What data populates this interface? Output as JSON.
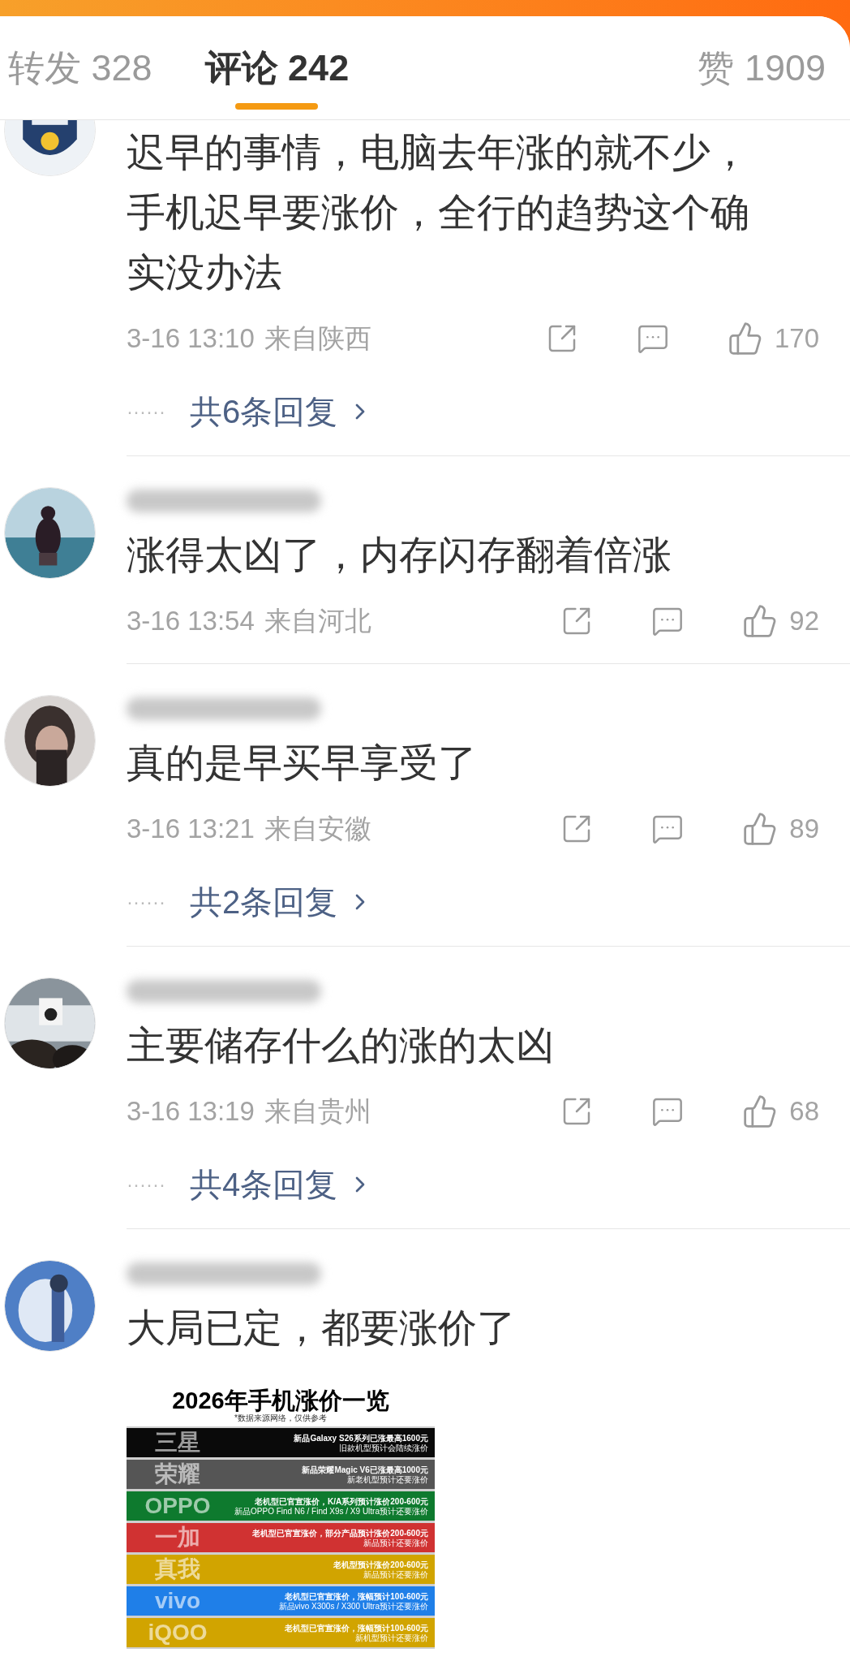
{
  "tabs": [
    {
      "label": "转发 328",
      "selected": false
    },
    {
      "label": "评论 242",
      "selected": true
    },
    {
      "label": "赞 1909",
      "selected": false
    }
  ],
  "comments": [
    {
      "text": "迟早的事情，电脑去年涨的就不少，手机迟早要涨价，全行的趋势这个确实没办法",
      "time": "3-16 13:10",
      "location": "来自陕西",
      "likes": "170",
      "replies": {
        "dots": "······",
        "label": "共6条回复"
      }
    },
    {
      "name_blurred": true,
      "text": "涨得太凶了，内存闪存翻着倍涨",
      "time": "3-16 13:54",
      "location": "来自河北",
      "likes": "92"
    },
    {
      "name_blurred": true,
      "text": "真的是早买早享受了",
      "time": "3-16 13:21",
      "location": "来自安徽",
      "likes": "89",
      "replies": {
        "dots": "······",
        "label": "共2条回复"
      }
    },
    {
      "name_blurred": true,
      "text": "主要储存什么的涨的太凶",
      "time": "3-16 13:19",
      "location": "来自贵州",
      "likes": "68",
      "replies": {
        "dots": "······",
        "label": "共4条回复"
      }
    },
    {
      "name_blurred": true,
      "text": "大局已定，都要涨价了",
      "attachment": {
        "title": "2026年手机涨价一览",
        "note": "*数据来源网络，仅供参考",
        "rows": [
          {
            "brand": "三星",
            "color": "#0a0a0a",
            "lines": [
              "新品Galaxy S26系列已涨最高1600元",
              "旧款机型预计会陆续涨价"
            ]
          },
          {
            "brand": "荣耀",
            "color": "#555555",
            "lines": [
              "新品荣耀Magic V6已涨最高1000元",
              "新老机型预计还要涨价"
            ]
          },
          {
            "brand": "OPPO",
            "color": "#0e7a2e",
            "lines": [
              "老机型已官宣涨价，K/A系列预计涨价200-600元",
              "新品OPPO Find N6 / Find X9s / X9 Ultra预计还要涨价"
            ]
          },
          {
            "brand": "一加",
            "color": "#d03232",
            "lines": [
              "老机型已官宣涨价，部分产品预计涨价200-600元",
              "新品预计还要涨价"
            ]
          },
          {
            "brand": "真我",
            "color": "#d1a400",
            "lines": [
              "老机型预计涨价200-600元",
              "新品预计还要涨价"
            ]
          },
          {
            "brand": "vivo",
            "color": "#1f7fe8",
            "lines": [
              "老机型已官宣涨价，涨幅预计100-600元",
              "新品vivo X300s / X300 Ultra预计还要涨价"
            ]
          },
          {
            "brand": "iQOO",
            "color": "#d1a400",
            "lines": [
              "老机型已官宣涨价，涨幅预计100-600元",
              "新机型预计还要涨价"
            ]
          }
        ]
      }
    }
  ]
}
